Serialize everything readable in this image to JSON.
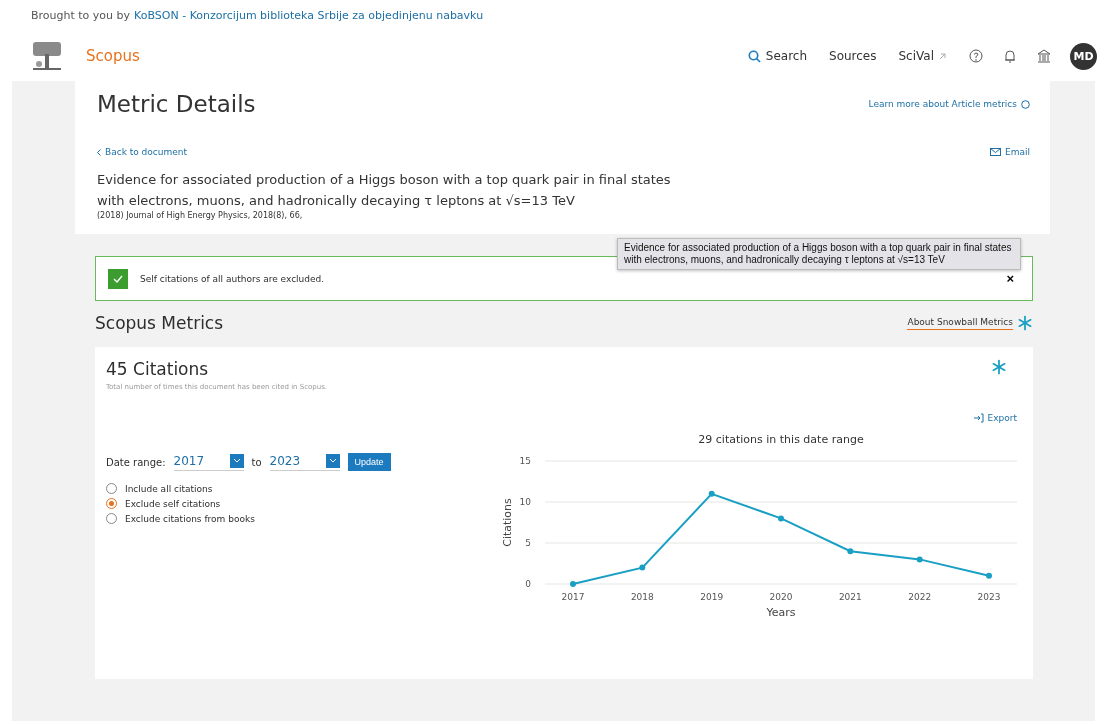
{
  "banner": {
    "prefix": "Brought to you by",
    "link": "KoBSON - Konzorcijum biblioteka Srbije za objedinjenu nabavku"
  },
  "header": {
    "brand": "Scopus",
    "nav": [
      {
        "kind": "search",
        "label": "Search"
      },
      {
        "kind": "plain",
        "label": "Sources"
      },
      {
        "kind": "external",
        "label": "SciVal"
      }
    ],
    "avatar": "MD"
  },
  "details": {
    "title": "Metric Details",
    "learn_more": "Learn more about Article metrics",
    "back": "Back to document",
    "email": "Email",
    "document_title": "Evidence for associated production of a Higgs boson with a top quark pair in final states with electrons, muons, and hadronically decaying τ leptons at √s=13 TeV",
    "source": "(2018) Journal of High Energy Physics, 2018(8),  66,",
    "tooltip": "Evidence for associated production of a Higgs boson with a top quark pair in final states with electrons, muons, and hadronically decaying τ leptons at √s=13 TeV"
  },
  "alert": {
    "message": "Self citations of all authors are excluded.",
    "close": "×"
  },
  "metrics": {
    "title": "Scopus Metrics",
    "about": "About Snowball Metrics"
  },
  "citations": {
    "title": "45 Citations",
    "subtitle": "Total number of times this document has been cited in Scopus.",
    "export": "Export",
    "date_label": "Date range:",
    "from": "2017",
    "to_label": "to",
    "to": "2023",
    "update": "Update",
    "options": [
      {
        "label": "Include all citations",
        "selected": false
      },
      {
        "label": "Exclude self citations",
        "selected": true
      },
      {
        "label": "Exclude citations from books",
        "selected": false
      }
    ],
    "chart_data": {
      "type": "line",
      "title": "29 citations in this date range",
      "xlabel": "Years",
      "ylabel": "Citations",
      "categories": [
        "2017",
        "2018",
        "2019",
        "2020",
        "2021",
        "2022",
        "2023"
      ],
      "ylim": [
        0,
        15
      ],
      "yticks": [
        0,
        5,
        10,
        15
      ],
      "series": [
        {
          "color": "#1a9fc4",
          "marker": true,
          "values": [
            0,
            2,
            11,
            8,
            4,
            3,
            1
          ]
        }
      ]
    }
  }
}
